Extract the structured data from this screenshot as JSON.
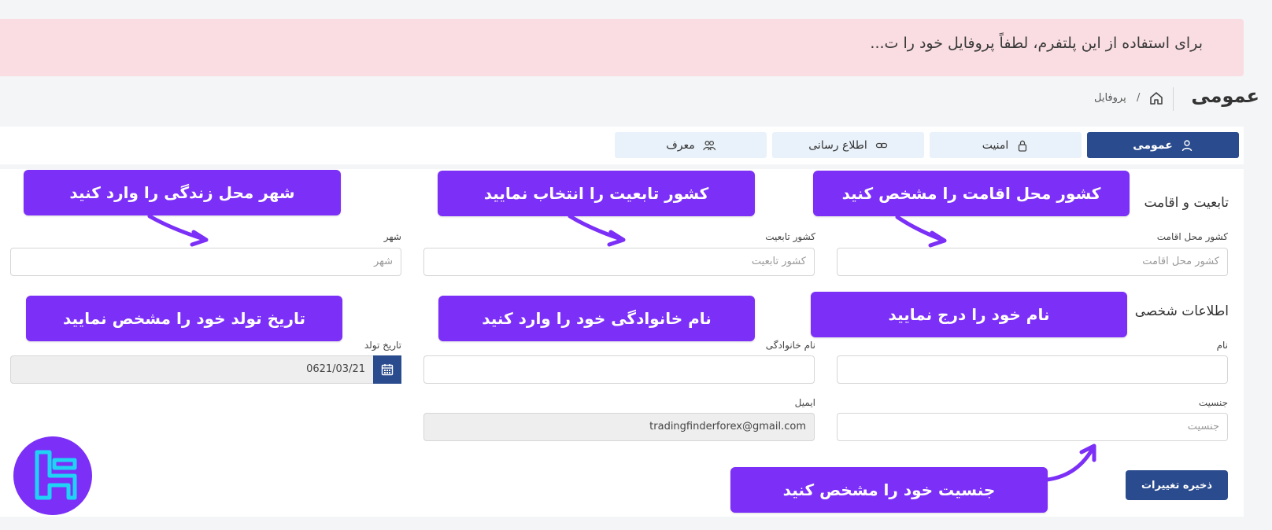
{
  "alert": {
    "text": "برای استفاده از این پلتفرم، لطفاً پروفایل خود را ت..."
  },
  "header": {
    "title": "عمومی",
    "breadcrumb_current": "پروفایل",
    "breadcrumb_separator": "/"
  },
  "tabs": [
    {
      "label": "عمومی",
      "icon": "user-icon",
      "active": true
    },
    {
      "label": "امنیت",
      "icon": "lock-icon",
      "active": false
    },
    {
      "label": "اطلاع رسانی",
      "icon": "link-icon",
      "active": false
    },
    {
      "label": "معرف",
      "icon": "users-icon",
      "active": false
    }
  ],
  "sections": {
    "residence": {
      "title": "تابعیت و اقامت",
      "country_residence": {
        "label": "کشور محل اقامت",
        "placeholder": "کشور محل اقامت"
      },
      "country_citizenship": {
        "label": "کشور تابعیت",
        "placeholder": "کشور تابعیت"
      },
      "city": {
        "label": "شهر",
        "placeholder": "شهر"
      }
    },
    "personal": {
      "title": "اطلاعات شخصی",
      "first_name": {
        "label": "نام",
        "value": ""
      },
      "last_name": {
        "label": "نام خانوادگی",
        "value": ""
      },
      "birth_date": {
        "label": "تاریخ تولد",
        "value": "0621/03/21"
      },
      "gender": {
        "label": "جنسیت",
        "placeholder": "جنسیت"
      },
      "email": {
        "label": "ایمیل",
        "value": "tradingfinderforex@gmail.com"
      }
    }
  },
  "save_button": "ذخیره تغییرات",
  "callouts": {
    "city": "شهر محل زندگی را وارد کنید",
    "citizenship": "کشور تابعیت را انتخاب نمایید",
    "residence": "کشور محل اقامت را مشخص کنید",
    "birth_date": "تاریخ تولد خود را مشخص نمایید",
    "last_name": "نام خانوادگی خود را وارد کنید",
    "first_name": "نام خود را درج نمایید",
    "gender": "جنسیت خود را مشخص کنید"
  },
  "colors": {
    "primary": "#2a4b8d",
    "callout": "#7b2ff7",
    "alert_bg": "#f9dde2",
    "tab_bg": "#e9f2fa",
    "logo_accent": "#1fd3f5"
  }
}
